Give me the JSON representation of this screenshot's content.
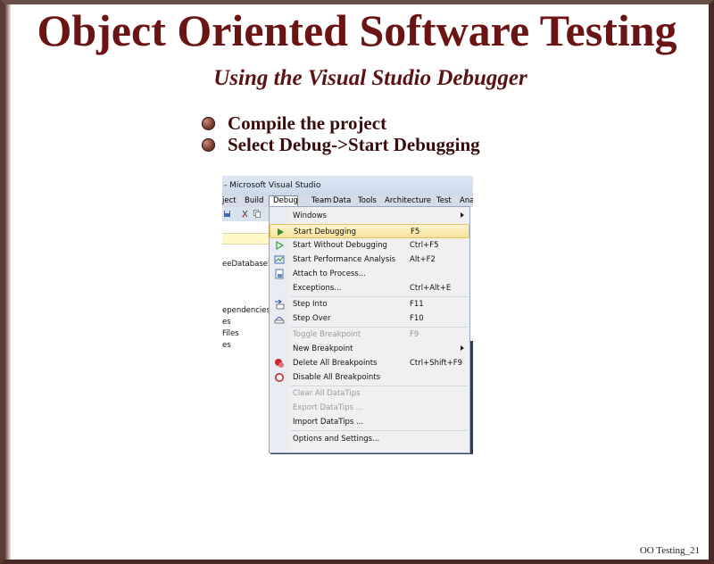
{
  "slide": {
    "title": "Object Oriented Software Testing",
    "subtitle": "Using the Visual Studio Debugger",
    "bullets": [
      "Compile the project",
      "Select Debug->Start Debugging"
    ],
    "footer": "OO Testing_21"
  },
  "vs": {
    "window_title": "- Microsoft Visual Studio",
    "menubar": [
      "ject",
      "Build",
      "Debug",
      "Team",
      "Data",
      "Tools",
      "Architecture",
      "Test",
      "Ana"
    ],
    "left_panel": [
      "eeDatabase' (",
      "ependencies",
      "es",
      "Files",
      "es"
    ],
    "debug_menu": [
      {
        "label": "Windows",
        "shortcut": "",
        "submenu": true,
        "icon": "",
        "enabled": true
      },
      {
        "label": "Start Debugging",
        "shortcut": "F5",
        "icon": "play-icon",
        "enabled": true,
        "highlighted": true
      },
      {
        "label": "Start Without Debugging",
        "shortcut": "Ctrl+F5",
        "icon": "play-outline-icon",
        "enabled": true
      },
      {
        "label": "Start Performance Analysis",
        "shortcut": "Alt+F2",
        "icon": "performance-icon",
        "enabled": true
      },
      {
        "label": "Attach to Process...",
        "shortcut": "",
        "icon": "attach-icon",
        "enabled": true
      },
      {
        "label": "Exceptions...",
        "shortcut": "Ctrl+Alt+E",
        "icon": "",
        "enabled": true
      },
      {
        "label": "Step Into",
        "shortcut": "F11",
        "icon": "step-into-icon",
        "enabled": true
      },
      {
        "label": "Step Over",
        "shortcut": "F10",
        "icon": "step-over-icon",
        "enabled": true
      },
      {
        "label": "Toggle Breakpoint",
        "shortcut": "F9",
        "icon": "",
        "enabled": false
      },
      {
        "label": "New Breakpoint",
        "shortcut": "",
        "submenu": true,
        "icon": "",
        "enabled": true
      },
      {
        "label": "Delete All Breakpoints",
        "shortcut": "Ctrl+Shift+F9",
        "icon": "delete-breakpoints-icon",
        "enabled": true
      },
      {
        "label": "Disable All Breakpoints",
        "shortcut": "",
        "icon": "disable-breakpoints-icon",
        "enabled": true
      },
      {
        "label": "Clear All DataTips",
        "shortcut": "",
        "icon": "",
        "enabled": false
      },
      {
        "label": "Export DataTips ...",
        "shortcut": "",
        "icon": "",
        "enabled": false
      },
      {
        "label": "Import DataTips ...",
        "shortcut": "",
        "icon": "",
        "enabled": true
      },
      {
        "label": "Options and Settings...",
        "shortcut": "",
        "icon": "",
        "enabled": true
      }
    ]
  }
}
